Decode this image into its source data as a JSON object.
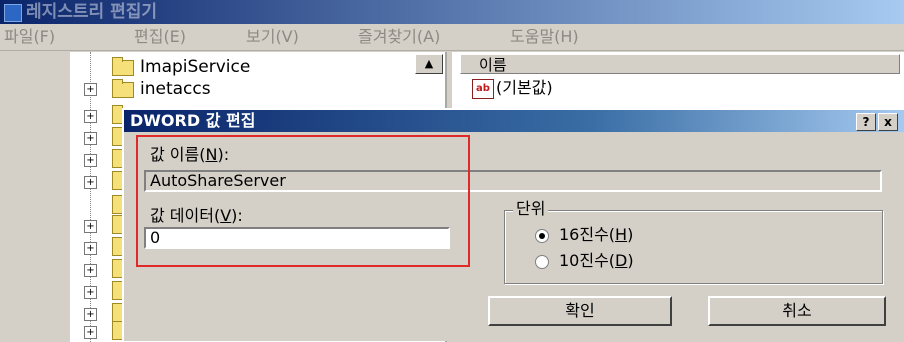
{
  "window": {
    "title": "레지스트리 편집기",
    "icon": "registry-editor-icon"
  },
  "menu": [
    {
      "label": "파일(F)"
    },
    {
      "label": "편집(E)"
    },
    {
      "label": "보기(V)"
    },
    {
      "label": "즐겨찾기(A)"
    },
    {
      "label": "도움말(H)"
    }
  ],
  "tree": {
    "items": [
      {
        "label": "ImapiService"
      },
      {
        "label": "inetaccs"
      }
    ]
  },
  "list": {
    "column_name": "이름",
    "default_value": "(기본값)"
  },
  "dialog": {
    "title": "DWORD 값 편집",
    "help_button": "?",
    "close_button": "x",
    "value_name_label": "값 이름(N):",
    "value_name": "AutoShareServer",
    "value_data_label": "값 데이터(V):",
    "value_data": "0",
    "base_group": "단위",
    "hex_label": "16진수(H)",
    "dec_label": "10진수(D)",
    "base_selected": "16진수",
    "ok_label": "확인",
    "cancel_label": "취소"
  },
  "highlight_color": "#e02a2a"
}
